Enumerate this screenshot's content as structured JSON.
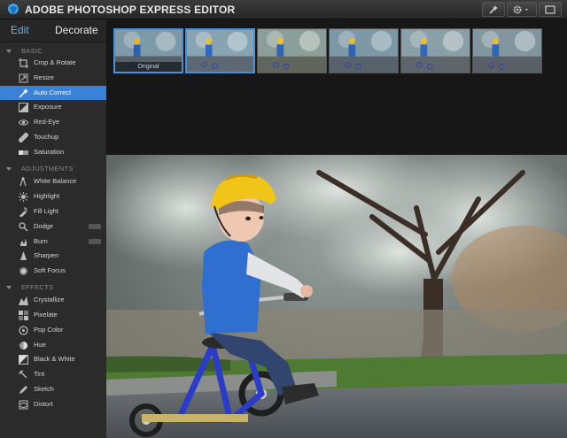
{
  "app": {
    "title": "ADOBE PHOTOSHOP EXPRESS EDITOR"
  },
  "tabs": [
    {
      "label": "Edit",
      "active": true
    },
    {
      "label": "Decorate",
      "active": false
    }
  ],
  "sections": [
    {
      "label": "BASIC",
      "tools": [
        {
          "label": "Crop & Rotate",
          "icon": "crop-icon"
        },
        {
          "label": "Resize",
          "icon": "resize-icon"
        },
        {
          "label": "Auto Correct",
          "icon": "magic-wand-icon",
          "active": true
        },
        {
          "label": "Exposure",
          "icon": "exposure-icon"
        },
        {
          "label": "Red-Eye",
          "icon": "eye-icon"
        },
        {
          "label": "Touchup",
          "icon": "bandage-icon"
        },
        {
          "label": "Saturation",
          "icon": "saturation-icon"
        }
      ]
    },
    {
      "label": "ADJUSTMENTS",
      "tools": [
        {
          "label": "White Balance",
          "icon": "white-balance-icon"
        },
        {
          "label": "Highlight",
          "icon": "highlight-icon"
        },
        {
          "label": "Fill Light",
          "icon": "fill-light-icon"
        },
        {
          "label": "Dodge",
          "icon": "dodge-icon",
          "badge": true
        },
        {
          "label": "Burn",
          "icon": "burn-icon",
          "badge": true
        },
        {
          "label": "Sharpen",
          "icon": "sharpen-icon"
        },
        {
          "label": "Soft Focus",
          "icon": "soft-focus-icon"
        }
      ]
    },
    {
      "label": "EFFECTS",
      "tools": [
        {
          "label": "Crystallize",
          "icon": "crystallize-icon"
        },
        {
          "label": "Pixelate",
          "icon": "pixelate-icon"
        },
        {
          "label": "Pop Color",
          "icon": "pop-color-icon"
        },
        {
          "label": "Hue",
          "icon": "hue-icon"
        },
        {
          "label": "Black & White",
          "icon": "black-white-icon"
        },
        {
          "label": "Tint",
          "icon": "tint-icon"
        },
        {
          "label": "Sketch",
          "icon": "sketch-icon"
        },
        {
          "label": "Distort",
          "icon": "distort-icon"
        }
      ]
    }
  ],
  "filmstrip": {
    "thumbnails": [
      {
        "caption": "Original",
        "selected": true
      },
      {
        "caption": "",
        "selected": true
      },
      {
        "caption": "",
        "selected": false
      },
      {
        "caption": "",
        "selected": false
      },
      {
        "caption": "",
        "selected": false
      },
      {
        "caption": "",
        "selected": false
      }
    ]
  },
  "colors": {
    "accent": "#3a82d8",
    "panel": "#2b2b2b",
    "edit_tab": "#6fb2f0"
  }
}
